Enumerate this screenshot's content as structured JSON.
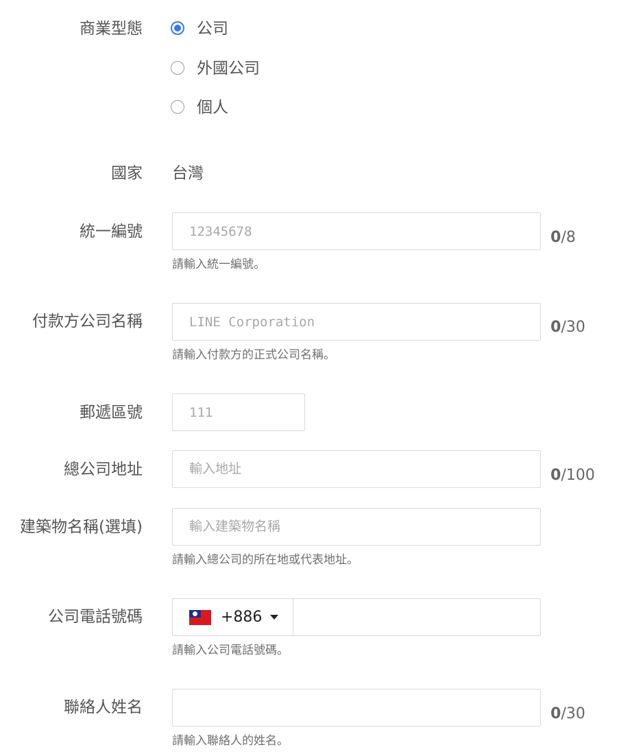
{
  "business_type": {
    "label": "商業型態",
    "options": [
      {
        "label": "公司",
        "selected": true
      },
      {
        "label": "外國公司",
        "selected": false
      },
      {
        "label": "個人",
        "selected": false
      }
    ]
  },
  "country": {
    "label": "國家",
    "value": "台灣"
  },
  "tax_id": {
    "label": "統一編號",
    "placeholder": "12345678",
    "value": "",
    "counter_current": "0",
    "counter_max": "/8",
    "help": "請輸入統一編號。"
  },
  "company_name": {
    "label": "付款方公司名稱",
    "placeholder": "LINE Corporation",
    "value": "",
    "counter_current": "0",
    "counter_max": "/30",
    "help": "請輸入付款方的正式公司名稱。"
  },
  "postal_code": {
    "label": "郵遞區號",
    "placeholder": "111",
    "value": ""
  },
  "address": {
    "label": "總公司地址",
    "placeholder": "輸入地址",
    "value": "",
    "counter_current": "0",
    "counter_max": "/100"
  },
  "building": {
    "label": "建築物名稱(選填)",
    "placeholder": "輸入建築物名稱",
    "value": "",
    "help": "請輸入總公司的所在地或代表地址。"
  },
  "phone": {
    "label": "公司電話號碼",
    "country_code": "+886",
    "flag_icon": "taiwan-flag-icon",
    "value": "",
    "help": "請輸入公司電話號碼。"
  },
  "contact_name": {
    "label": "聯絡人姓名",
    "placeholder": "",
    "value": "",
    "counter_current": "0",
    "counter_max": "/30",
    "help": "請輸入聯絡人的姓名。"
  },
  "colors": {
    "accent": "#3478f6",
    "border": "#d9d9d9",
    "label": "#555555"
  }
}
